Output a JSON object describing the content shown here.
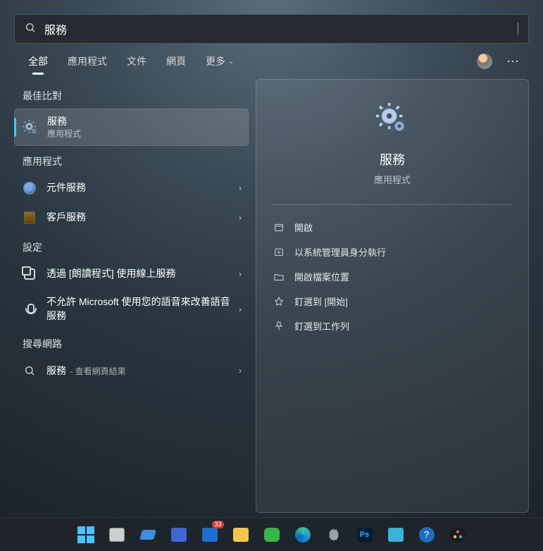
{
  "search": {
    "value": "服務"
  },
  "tabs": {
    "items": [
      "全部",
      "應用程式",
      "文件",
      "網頁",
      "更多"
    ],
    "active_index": 0
  },
  "sections": {
    "best_match": "最佳比對",
    "apps": "應用程式",
    "settings": "設定",
    "web": "搜尋網路"
  },
  "best_match": {
    "title": "服務",
    "subtitle": "應用程式"
  },
  "apps": [
    {
      "title": "元件服務"
    },
    {
      "title": "客戶服務"
    }
  ],
  "settings": [
    {
      "title": "透過 [朗讀程式] 使用線上服務"
    },
    {
      "title": "不允許 Microsoft 使用您的語音來改善語音服務"
    }
  ],
  "web": {
    "title": "服務",
    "suffix": " - 查看網頁結果"
  },
  "preview": {
    "title": "服務",
    "subtitle": "應用程式",
    "actions": {
      "open": "開啟",
      "admin": "以系統管理員身分執行",
      "open_loc": "開啟檔案位置",
      "pin_start": "釘選到 [開始]",
      "pin_taskbar": "釘選到工作列"
    }
  },
  "taskbar": {
    "mail_badge": "33"
  }
}
